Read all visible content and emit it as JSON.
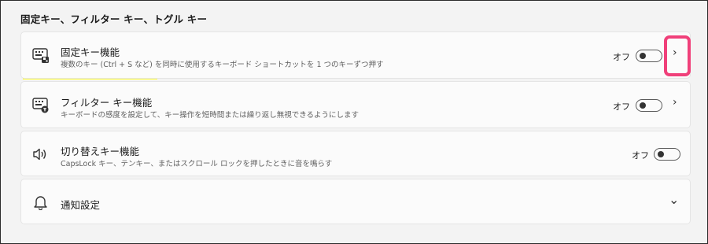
{
  "section": {
    "title": "固定キー、フィルター キー、トグル キー"
  },
  "sticky_keys": {
    "title": "固定キー機能",
    "description": "複数のキー (Ctrl + S など) を同時に使用するキーボード ショートカットを 1 つのキーずつ押す",
    "state_label": "オフ",
    "toggle_on": false,
    "icon": "keyboard-sticky-icon",
    "chevron": "›"
  },
  "filter_keys": {
    "title": "フィルター キー機能",
    "description": "キーボードの感度を設定して、キー操作を短時間または繰り返し無視できるようにします",
    "state_label": "オフ",
    "toggle_on": false,
    "icon": "keyboard-filter-icon",
    "chevron": "›"
  },
  "toggle_keys": {
    "title": "切り替えキー機能",
    "description": "CapsLock キー、テンキー、またはスクロール ロックを押したときに音を鳴らす",
    "state_label": "オフ",
    "toggle_on": false,
    "icon": "speaker-icon"
  },
  "notifications": {
    "title": "通知設定",
    "icon": "bell-icon",
    "chevron": "⌄"
  },
  "annotations": {
    "highlight_color": "#ffff33",
    "callout_color": "#f0407a"
  }
}
